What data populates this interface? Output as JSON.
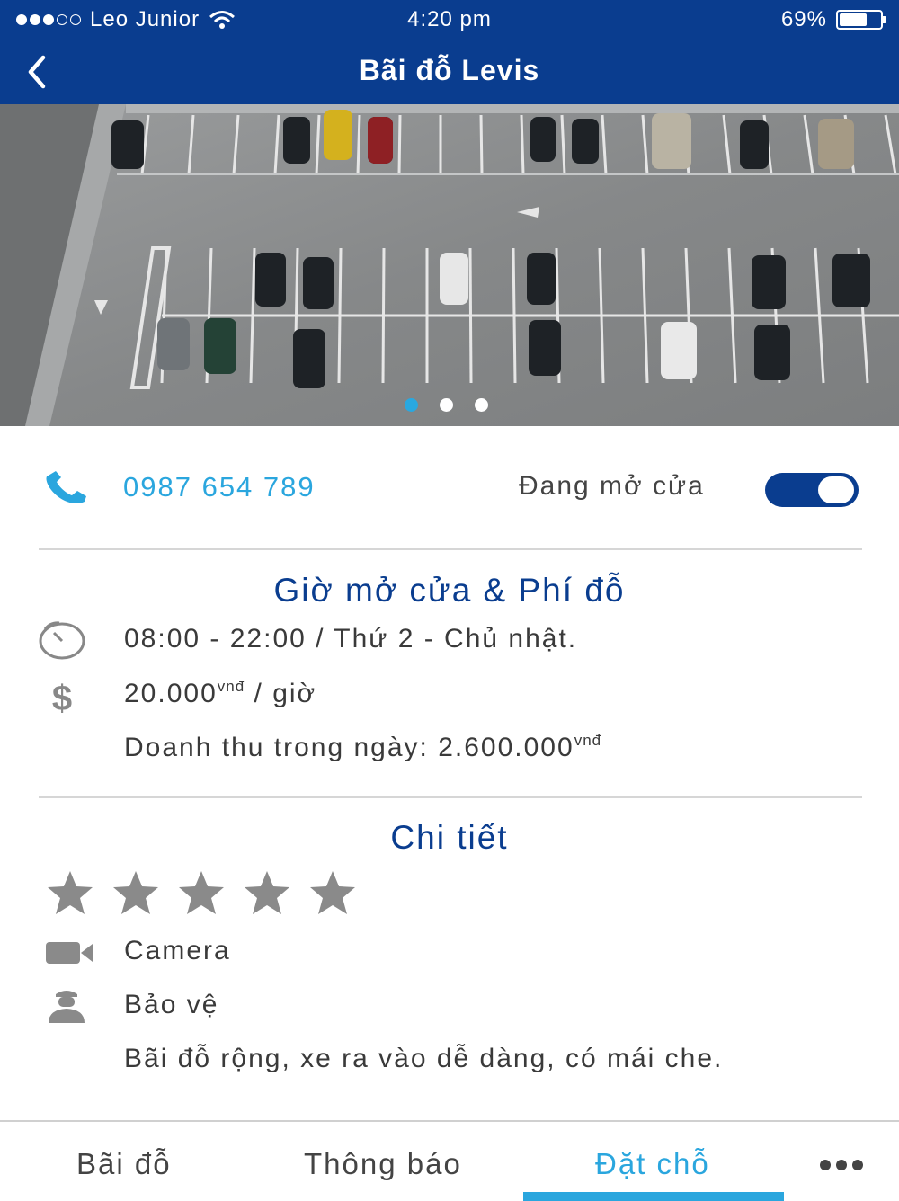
{
  "status_bar": {
    "carrier": "Leo Junior",
    "time": "4:20 pm",
    "battery": "69%",
    "battery_level": 0.69,
    "signal_bars_filled": 3,
    "signal_bars_total": 5
  },
  "header": {
    "title": "Bãi đỗ Levis",
    "back_icon": "chevron-left-icon"
  },
  "hero": {
    "carousel_total": 3,
    "carousel_active_index": 0
  },
  "contact": {
    "phone": "0987 654 789",
    "open_status_label": "Đang mở cửa",
    "open_toggle_on": true
  },
  "hours_section": {
    "title": "Giờ mở cửa & Phí đỗ",
    "hours": "08:00 - 22:00  /  Thứ 2 - Chủ nhật.",
    "price": "20.000",
    "price_unit": "vnđ",
    "price_suffix": " / giờ",
    "revenue_label": "Doanh thu trong ngày: 2.600.000",
    "revenue_unit": "vnđ"
  },
  "details_section": {
    "title": "Chi tiết",
    "rating": 5,
    "rating_max": 5,
    "camera_label": "Camera",
    "guard_label": "Bảo vệ",
    "description": "Bãi đỗ rộng, xe ra vào dễ dàng, có mái che."
  },
  "tabbar": {
    "tabs": [
      "Bãi đỗ",
      "Thông báo",
      "Đặt chỗ"
    ],
    "active_index": 2
  },
  "colors": {
    "primary": "#0a3d8f",
    "accent": "#2aa6de",
    "text": "#3a3a3a"
  }
}
